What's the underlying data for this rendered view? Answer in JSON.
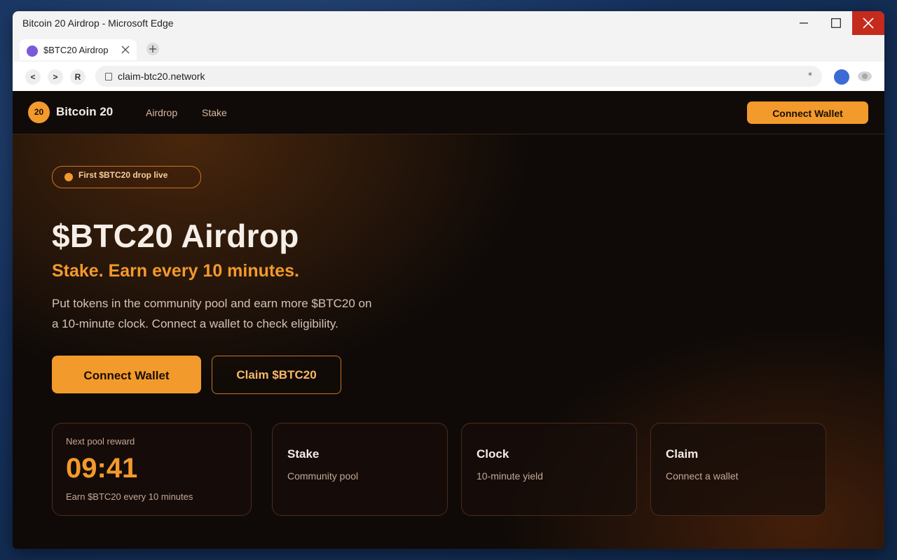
{
  "window": {
    "title": "Bitcoin 20 Airdrop - Microsoft Edge"
  },
  "tab": {
    "label": "$BTC20 Airdrop"
  },
  "toolbar": {
    "back": "<",
    "forward": ">",
    "reload": "R",
    "url": "claim-btc20.network",
    "favorite": "*"
  },
  "site": {
    "logo_text": "20",
    "brand": "Bitcoin 20",
    "nav": [
      "Airdrop",
      "Stake"
    ],
    "nav_connect": "Connect Wallet"
  },
  "hero": {
    "pill": "First $BTC20 drop live",
    "title": "$BTC20 Airdrop",
    "subtitle": "Stake. Earn every 10 minutes.",
    "description": "Put tokens in the community pool and earn more $BTC20 on a 10-minute clock. Connect a wallet to check eligibility.",
    "primary_cta": "Connect Wallet",
    "secondary_cta": "Claim $BTC20"
  },
  "timer_card": {
    "label": "Next pool reward",
    "time": "09:41",
    "footer": "Earn $BTC20 every 10 minutes"
  },
  "feature_cards": [
    {
      "title": "Stake",
      "subtitle": "Community pool"
    },
    {
      "title": "Clock",
      "subtitle": "10-minute yield"
    },
    {
      "title": "Claim",
      "subtitle": "Connect a wallet"
    }
  ],
  "colors": {
    "accent": "#f39a2c",
    "close_button": "#c42b1c",
    "page_bg": "#0f0a08"
  }
}
